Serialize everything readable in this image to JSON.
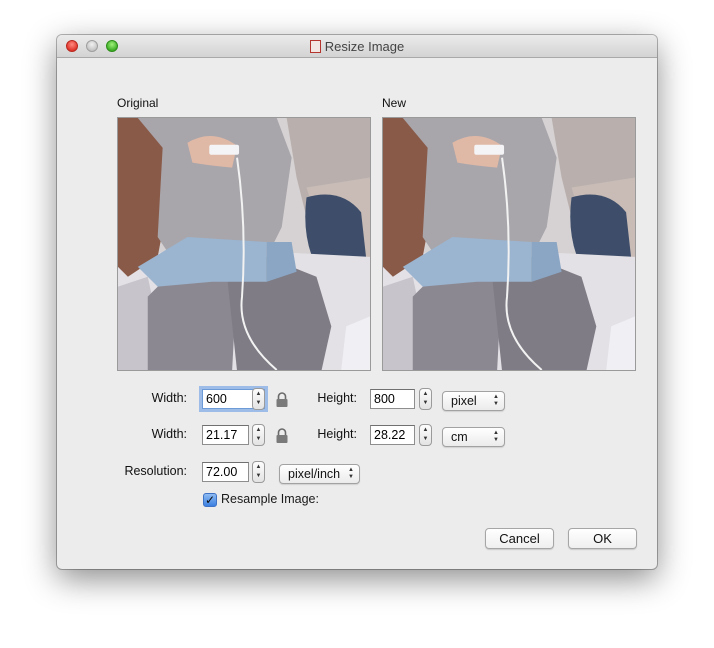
{
  "window": {
    "title": "Resize Image"
  },
  "preview": {
    "original_label": "Original",
    "new_label": "New"
  },
  "pixels_row": {
    "width_label": "Width:",
    "width_value": "600",
    "height_label": "Height:",
    "height_value": "800",
    "unit": "pixel"
  },
  "cm_row": {
    "width_label": "Width:",
    "width_value": "21.17",
    "height_label": "Height:",
    "height_value": "28.22",
    "unit": "cm"
  },
  "resolution_row": {
    "label": "Resolution:",
    "value": "72.00",
    "unit": "pixel/inch"
  },
  "resample": {
    "label": "Resample Image:",
    "checked": true
  },
  "buttons": {
    "cancel": "Cancel",
    "ok": "OK"
  }
}
